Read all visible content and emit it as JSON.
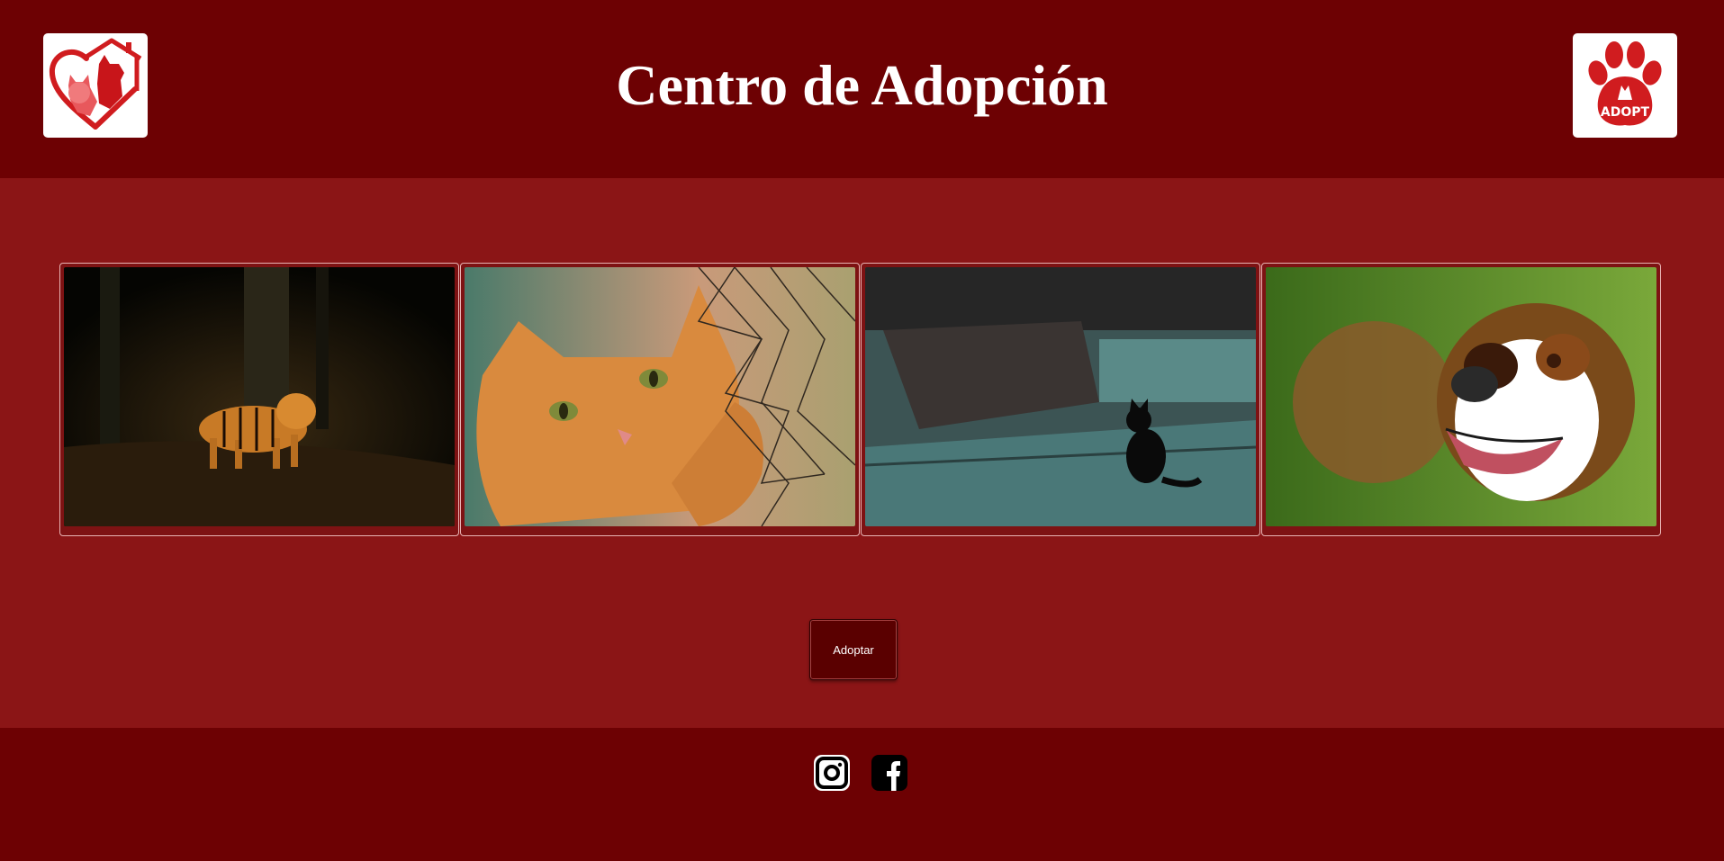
{
  "header": {
    "title": "Centro de Adopción",
    "logo_left_icon": "heart-house-pets-logo",
    "logo_right_icon": "paw-adopt-logo",
    "logo_right_text": "ADOPT"
  },
  "gallery": {
    "items": [
      {
        "icon": "tiger-photo"
      },
      {
        "icon": "orange-cat-photo"
      },
      {
        "icon": "black-cat-photo"
      },
      {
        "icon": "bulldog-photo"
      }
    ]
  },
  "actions": {
    "adopt_label": "Adoptar"
  },
  "footer": {
    "social": [
      {
        "icon": "instagram-icon"
      },
      {
        "icon": "facebook-icon"
      }
    ]
  },
  "colors": {
    "header_bg": "#6d0103",
    "main_bg": "#8b1516",
    "footer_bg": "#6d0103",
    "button_bg": "#5a0000",
    "brand_red": "#d01c1f"
  }
}
